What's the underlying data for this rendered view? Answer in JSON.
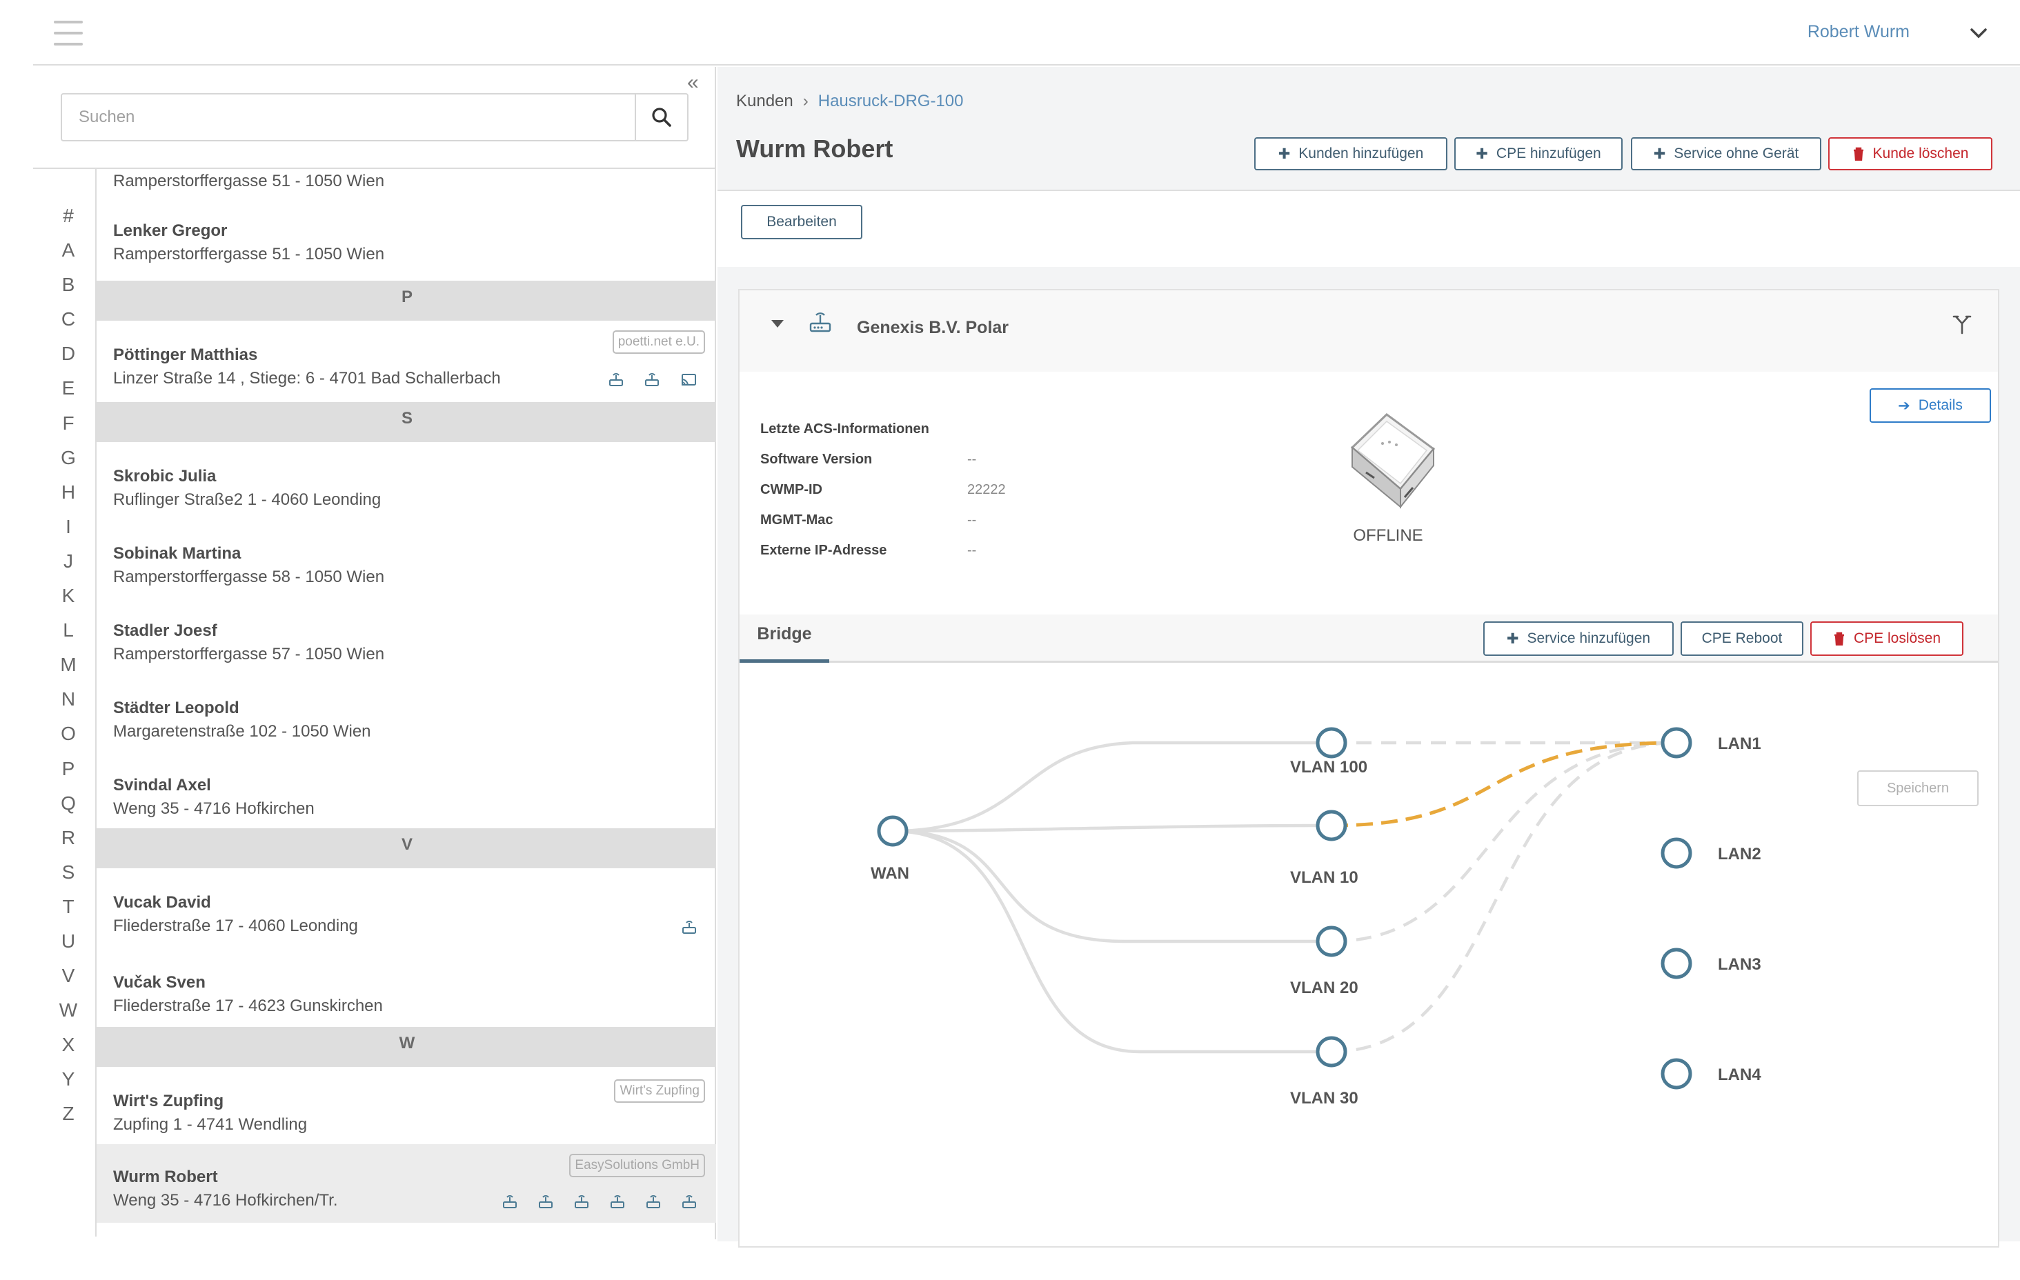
{
  "topbar": {
    "user_name": "Robert Wurm"
  },
  "search": {
    "placeholder": "Suchen"
  },
  "alphabet": [
    "#",
    "A",
    "B",
    "C",
    "D",
    "E",
    "F",
    "G",
    "H",
    "I",
    "J",
    "K",
    "L",
    "M",
    "N",
    "O",
    "P",
    "Q",
    "R",
    "S",
    "T",
    "U",
    "V",
    "W",
    "X",
    "Y",
    "Z"
  ],
  "customers": {
    "partial_address": "Ramperstorffergasse 51 - 1050 Wien",
    "items": [
      {
        "name": "Lenker Gregor",
        "address": "Ramperstorffergasse 51 - 1050 Wien"
      },
      {
        "name": "Pöttinger Matthias",
        "address": "Linzer Straße 14 , Stiege: 6 - 4701 Bad Schallerbach",
        "tag": "poetti.net e.U."
      },
      {
        "name": "Skrobic Julia",
        "address": "Ruflinger Straße2 1 - 4060 Leonding"
      },
      {
        "name": "Sobinak Martina",
        "address": "Ramperstorffergasse 58 - 1050 Wien"
      },
      {
        "name": "Stadler Joesf",
        "address": "Ramperstorffergasse 57 - 1050 Wien"
      },
      {
        "name": "Städter Leopold",
        "address": "Margaretenstraße 102 - 1050 Wien"
      },
      {
        "name": "Svindal Axel",
        "address": "Weng 35 - 4716 Hofkirchen"
      },
      {
        "name": "Vucak David",
        "address": "Fliederstraße 17 - 4060 Leonding"
      },
      {
        "name": "Vučak Sven",
        "address": "Fliederstraße 17 - 4623 Gunskirchen"
      },
      {
        "name": "Wirt's Zupfing",
        "address": "Zupfing 1 - 4741 Wendling",
        "tag": "Wirt's Zupfing"
      },
      {
        "name": "Wurm Robert",
        "address": "Weng 35 - 4716 Hofkirchen/Tr.",
        "tag": "EasySolutions GmbH"
      }
    ],
    "separators": [
      "P",
      "S",
      "V",
      "W"
    ]
  },
  "breadcrumb": {
    "root": "Kunden",
    "current": "Hausruck-DRG-100"
  },
  "page": {
    "title": "Wurm Robert",
    "btn_add_customer": "Kunden hinzufügen",
    "btn_add_cpe": "CPE hinzufügen",
    "btn_service_no_device": "Service ohne Gerät",
    "btn_delete_customer": "Kunde löschen",
    "btn_edit": "Bearbeiten"
  },
  "device": {
    "name": "Genexis B.V. Polar",
    "details_label": "Details",
    "acs_title": "Letzte ACS-Informationen",
    "fields": [
      {
        "label": "Software Version",
        "value": "--"
      },
      {
        "label": "CWMP-ID",
        "value": "22222"
      },
      {
        "label": "MGMT-Mac",
        "value": "--"
      },
      {
        "label": "Externe IP-Adresse",
        "value": "--"
      }
    ],
    "status": "OFFLINE"
  },
  "bridge": {
    "tab_label": "Bridge",
    "btn_add_service": "Service hinzufügen",
    "btn_reboot": "CPE Reboot",
    "btn_detach": "CPE loslösen",
    "btn_save": "Speichern",
    "nodes": {
      "wan": "WAN",
      "vlans": [
        "VLAN 100",
        "VLAN 10",
        "VLAN 20",
        "VLAN 30"
      ],
      "lans": [
        "LAN1",
        "LAN2",
        "LAN3",
        "LAN4"
      ]
    },
    "colors": {
      "node": "#4b7a93",
      "link": "#dcdcdc",
      "active_link": "#e8a83a"
    }
  }
}
